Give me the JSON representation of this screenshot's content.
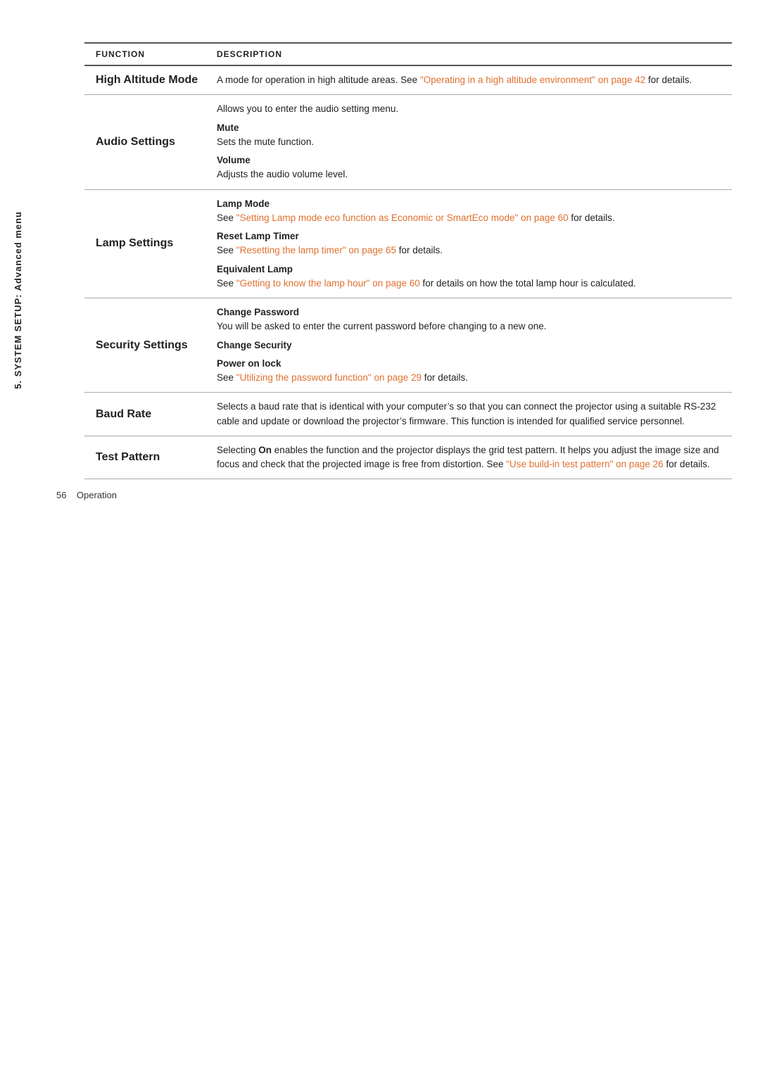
{
  "sidebar": {
    "label": "5. SYSTEM SETUP: Advanced menu"
  },
  "table": {
    "col1_header": "FUNCTION",
    "col2_header": "DESCRIPTION",
    "rows": [
      {
        "function": "High Altitude Mode",
        "description_html": "high_altitude"
      },
      {
        "function": "Audio Settings",
        "description_html": "audio_settings"
      },
      {
        "function": "Lamp Settings",
        "description_html": "lamp_settings"
      },
      {
        "function": "Security Settings",
        "description_html": "security_settings"
      },
      {
        "function": "Baud Rate",
        "description_html": "baud_rate"
      },
      {
        "function": "Test Pattern",
        "description_html": "test_pattern"
      }
    ],
    "descriptions": {
      "high_altitude": {
        "plain": "A mode for operation in high altitude areas. See ",
        "link1": "\"Operating in a high altitude environment\" on page 42",
        "plain2": " for details."
      },
      "audio_settings": {
        "intro": "Allows you to enter the audio setting menu.",
        "mute_label": "Mute",
        "mute_desc": "Sets the mute function.",
        "volume_label": "Volume",
        "volume_desc": "Adjusts the audio volume level."
      },
      "lamp_settings": {
        "lamp_mode_label": "Lamp Mode",
        "lamp_mode_pre": "See ",
        "lamp_mode_link": "\"Setting Lamp mode eco function as Economic or SmartEco mode\" on page 60",
        "lamp_mode_post": " for details.",
        "reset_label": "Reset Lamp Timer",
        "reset_pre": "See ",
        "reset_link": "\"Resetting the lamp timer\" on page 65",
        "reset_post": " for details.",
        "equiv_label": "Equivalent Lamp",
        "equiv_pre": "See ",
        "equiv_link": "\"Getting to know the lamp hour\" on page 60",
        "equiv_post": " for details on how the total lamp hour is calculated."
      },
      "security_settings": {
        "change_pw_label": "Change Password",
        "change_pw_desc": "You will be asked to enter the current password before changing to a new one.",
        "change_sec_label": "Change Security",
        "power_on_label": "Power on lock",
        "power_on_pre": "See ",
        "power_on_link": "\"Utilizing the password function\" on page 29",
        "power_on_post": " for details."
      },
      "baud_rate": {
        "text": "Selects a baud rate that is identical with your computer’s so that you can connect the projector using a suitable RS-232 cable and update or download the projector’s firmware. This function is intended for qualified service personnel."
      },
      "test_pattern": {
        "pre": "Selecting ",
        "bold": "On",
        "post": " enables the function and the projector displays the grid test pattern. It helps you adjust the image size and focus and check that the projected image is free from distortion. See ",
        "link": "\"Use build-in test pattern\" on page 26",
        "post2": " for details."
      }
    }
  },
  "footer": {
    "page_num": "56",
    "label": "Operation"
  }
}
